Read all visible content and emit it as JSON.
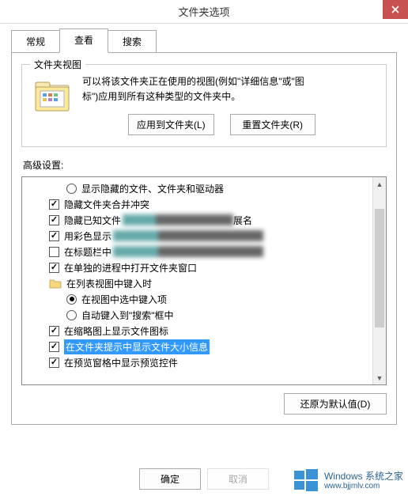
{
  "title": "文件夹选项",
  "tabs": {
    "general": "常规",
    "view": "查看",
    "search": "搜索"
  },
  "groupbox": {
    "title": "文件夹视图",
    "text_line1": "可以将该文件夹正在使用的视图(例如\"详细信息\"或\"图",
    "text_line2": "标\")应用到所有这种类型的文件夹中。",
    "apply_btn": "应用到文件夹(L)",
    "reset_btn": "重置文件夹(R)"
  },
  "advanced_label": "高级设置:",
  "tree": {
    "i0": {
      "type": "radio",
      "checked": false,
      "text": "显示隐藏的文件、文件夹和驱动器",
      "lv": 2
    },
    "i1": {
      "type": "check",
      "checked": true,
      "text": "隐藏文件夹合并冲突",
      "lv": 1
    },
    "i2": {
      "type": "check",
      "checked": true,
      "text": "隐藏已知文件",
      "tail": "展名",
      "lv": 1,
      "blur": true
    },
    "i3": {
      "type": "check",
      "checked": true,
      "text": "用彩色显示",
      "lv": 1,
      "blur": true
    },
    "i4": {
      "type": "check",
      "checked": false,
      "text": "在标题栏中",
      "lv": 1,
      "blur": true
    },
    "i5": {
      "type": "check",
      "checked": true,
      "text": "在单独的进程中打开文件夹窗口",
      "lv": 1
    },
    "i6": {
      "type": "folder",
      "text": "在列表视图中键入时",
      "lv": 1
    },
    "i7": {
      "type": "radio",
      "checked": true,
      "text": "在视图中选中键入项",
      "lv": 2
    },
    "i8": {
      "type": "radio",
      "checked": false,
      "text": "自动键入到\"搜索\"框中",
      "lv": 2
    },
    "i9": {
      "type": "check",
      "checked": true,
      "text": "在缩略图上显示文件图标",
      "lv": 1
    },
    "i10": {
      "type": "check",
      "checked": true,
      "text": "在文件夹提示中显示文件大小信息",
      "lv": 1,
      "sel": true
    },
    "i11": {
      "type": "check",
      "checked": true,
      "text": "在预览窗格中显示预览控件",
      "lv": 1
    }
  },
  "restore_btn": "还原为默认值(D)",
  "ok_btn": "确定",
  "cancel_btn": "取消",
  "watermark": {
    "brand": "Windows",
    "sub": "系统之家",
    "domain": "www.bjjmlv.com"
  }
}
